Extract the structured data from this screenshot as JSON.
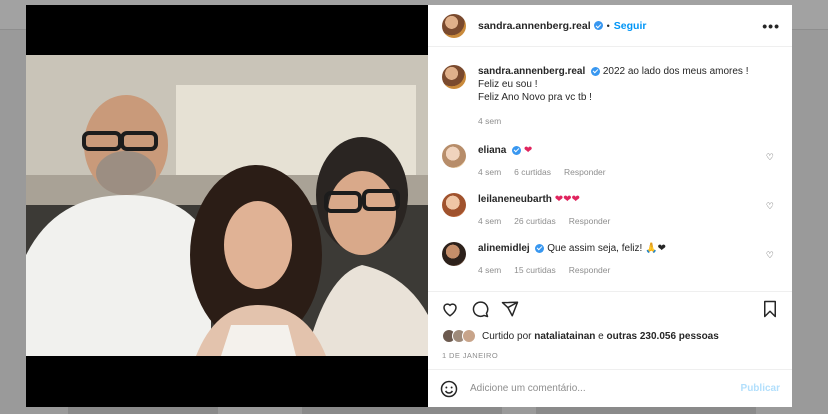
{
  "post": {
    "username": "sandra.annenberg.real",
    "follow_label": "Seguir",
    "more_label": "•••",
    "separator": "•"
  },
  "caption": {
    "username": "sandra.annenberg.real",
    "line1": "2022 ao lado dos meus amores !",
    "line2": "Feliz eu sou !",
    "line3": "Feliz Ano Novo pra vc tb !",
    "time": "4 sem"
  },
  "comments": [
    {
      "username": "eliana",
      "text": "❤",
      "time": "4 sem",
      "likes": "6 curtidas",
      "reply": "Responder"
    },
    {
      "username": "leilaneneubarth",
      "text": "❤❤❤",
      "time": "4 sem",
      "likes": "26 curtidas",
      "reply": "Responder"
    },
    {
      "username": "alinemidlej",
      "text": "Que assim seja, feliz! 🙏❤",
      "time": "4 sem",
      "likes": "15 curtidas",
      "reply": "Responder"
    }
  ],
  "likes": {
    "prefix": "Curtido por",
    "user": "nataliatainan",
    "conj": "e",
    "others": "outras 230.056 pessoas"
  },
  "date": "1 DE JANEIRO",
  "comment_box": {
    "placeholder": "Adicione um comentário...",
    "publish_label": "Publicar"
  },
  "colors": {
    "link_blue": "#0095f6",
    "verified_blue": "#3897f0",
    "heart_red": "#e0245e"
  },
  "icons": [
    "heart-icon",
    "comment-icon",
    "share-icon",
    "bookmark-icon",
    "emoji-icon",
    "verified-icon"
  ]
}
